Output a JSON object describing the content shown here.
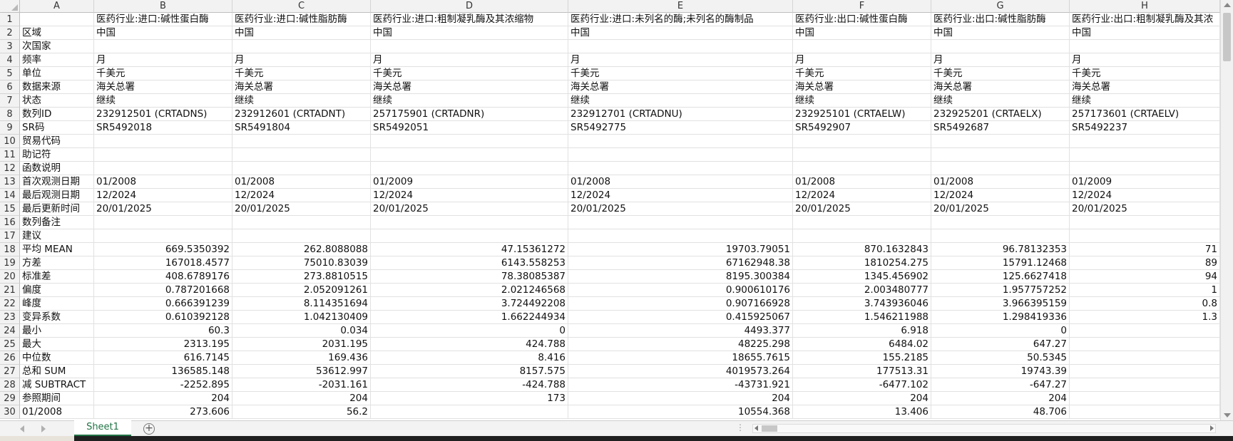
{
  "columns": [
    "A",
    "B",
    "C",
    "D",
    "E",
    "F",
    "G",
    "H"
  ],
  "rows": [
    {
      "num": "1",
      "cells": [
        "",
        "医药行业:进口:碱性蛋白酶",
        "医药行业:进口:碱性脂肪酶",
        "医药行业:进口:粗制凝乳酶及其浓缩物",
        "医药行业:进口:未列名的酶;未列名的酶制品",
        "医药行业:出口:碱性蛋白酶",
        "医药行业:出口:碱性脂肪酶",
        "医药行业:出口:粗制凝乳酶及其浓"
      ]
    },
    {
      "num": "2",
      "cells": [
        "区域",
        "中国",
        "中国",
        "中国",
        "中国",
        "中国",
        "中国",
        "中国"
      ]
    },
    {
      "num": "3",
      "cells": [
        "次国家",
        "",
        "",
        "",
        "",
        "",
        "",
        ""
      ]
    },
    {
      "num": "4",
      "cells": [
        "频率",
        "月",
        "月",
        "月",
        "月",
        "月",
        "月",
        "月"
      ]
    },
    {
      "num": "5",
      "cells": [
        "单位",
        "千美元",
        "千美元",
        "千美元",
        "千美元",
        "千美元",
        "千美元",
        "千美元"
      ]
    },
    {
      "num": "6",
      "cells": [
        "数据来源",
        "海关总署",
        "海关总署",
        "海关总署",
        "海关总署",
        "海关总署",
        "海关总署",
        "海关总署"
      ]
    },
    {
      "num": "7",
      "cells": [
        "状态",
        "继续",
        "继续",
        "继续",
        "继续",
        "继续",
        "继续",
        "继续"
      ]
    },
    {
      "num": "8",
      "cells": [
        "数列ID",
        "232912501 (CRTADNS)",
        "232912601 (CRTADNT)",
        "257175901 (CRTADNR)",
        "232912701 (CRTADNU)",
        "232925101 (CRTAELW)",
        "232925201 (CRTAELX)",
        "257173601 (CRTAELV)"
      ]
    },
    {
      "num": "9",
      "cells": [
        "SR码",
        "SR5492018",
        "SR5491804",
        "SR5492051",
        "SR5492775",
        "SR5492907",
        "SR5492687",
        "SR5492237"
      ]
    },
    {
      "num": "10",
      "cells": [
        "贸易代码",
        "",
        "",
        "",
        "",
        "",
        "",
        ""
      ]
    },
    {
      "num": "11",
      "cells": [
        "助记符",
        "",
        "",
        "",
        "",
        "",
        "",
        ""
      ]
    },
    {
      "num": "12",
      "cells": [
        "函数说明",
        "",
        "",
        "",
        "",
        "",
        "",
        ""
      ]
    },
    {
      "num": "13",
      "cells": [
        "首次观测日期",
        "01/2008",
        "01/2008",
        "01/2009",
        "01/2008",
        "01/2008",
        "01/2008",
        "01/2009"
      ]
    },
    {
      "num": "14",
      "cells": [
        "最后观测日期",
        "12/2024",
        "12/2024",
        "12/2024",
        "12/2024",
        "12/2024",
        "12/2024",
        "12/2024"
      ]
    },
    {
      "num": "15",
      "cells": [
        "最后更新时间",
        "20/01/2025",
        "20/01/2025",
        "20/01/2025",
        "20/01/2025",
        "20/01/2025",
        "20/01/2025",
        "20/01/2025"
      ]
    },
    {
      "num": "16",
      "cells": [
        "数列备注",
        "",
        "",
        "",
        "",
        "",
        "",
        ""
      ]
    },
    {
      "num": "17",
      "cells": [
        "建议",
        "",
        "",
        "",
        "",
        "",
        "",
        ""
      ]
    },
    {
      "num": "18",
      "cells": [
        "平均 MEAN",
        "669.5350392",
        "262.8088088",
        "47.15361272",
        "19703.79051",
        "870.1632843",
        "96.78132353",
        "71"
      ]
    },
    {
      "num": "19",
      "cells": [
        "方差",
        "167018.4577",
        "75010.83039",
        "6143.558253",
        "67162948.38",
        "1810254.275",
        "15791.12468",
        "89"
      ]
    },
    {
      "num": "20",
      "cells": [
        "标准差",
        "408.6789176",
        "273.8810515",
        "78.38085387",
        "8195.300384",
        "1345.456902",
        "125.6627418",
        "94"
      ]
    },
    {
      "num": "21",
      "cells": [
        "偏度",
        "0.787201668",
        "2.052091261",
        "2.021246568",
        "0.900610176",
        "2.003480777",
        "1.957757252",
        "1"
      ]
    },
    {
      "num": "22",
      "cells": [
        "峰度",
        "0.666391239",
        "8.114351694",
        "3.724492208",
        "0.907166928",
        "3.743936046",
        "3.966395159",
        "0.8"
      ]
    },
    {
      "num": "23",
      "cells": [
        "变异系数",
        "0.610392128",
        "1.042130409",
        "1.662244934",
        "0.415925067",
        "1.546211988",
        "1.298419336",
        "1.3"
      ]
    },
    {
      "num": "24",
      "cells": [
        "最小",
        "60.3",
        "0.034",
        "0",
        "4493.377",
        "6.918",
        "0",
        ""
      ]
    },
    {
      "num": "25",
      "cells": [
        "最大",
        "2313.195",
        "2031.195",
        "424.788",
        "48225.298",
        "6484.02",
        "647.27",
        ""
      ]
    },
    {
      "num": "26",
      "cells": [
        "中位数",
        "616.7145",
        "169.436",
        "8.416",
        "18655.7615",
        "155.2185",
        "50.5345",
        ""
      ]
    },
    {
      "num": "27",
      "cells": [
        "总和 SUM",
        "136585.148",
        "53612.997",
        "8157.575",
        "4019573.264",
        "177513.31",
        "19743.39",
        ""
      ]
    },
    {
      "num": "28",
      "cells": [
        "减 SUBTRACT",
        "-2252.895",
        "-2031.161",
        "-424.788",
        "-43731.921",
        "-6477.102",
        "-647.27",
        ""
      ]
    },
    {
      "num": "29",
      "cells": [
        "参照期间",
        "204",
        "204",
        "173",
        "204",
        "204",
        "204",
        ""
      ]
    },
    {
      "num": "30",
      "cells": [
        "01/2008",
        "273.606",
        "56.2",
        "",
        "10554.368",
        "13.406",
        "48.706",
        ""
      ]
    }
  ],
  "sheet_tab": "Sheet1",
  "add_sheet_symbol": "+",
  "more_symbol": "⋮",
  "colors": {
    "accent": "#217346",
    "header_bg": "#f2f2f2",
    "grid": "#e1e1e1"
  }
}
